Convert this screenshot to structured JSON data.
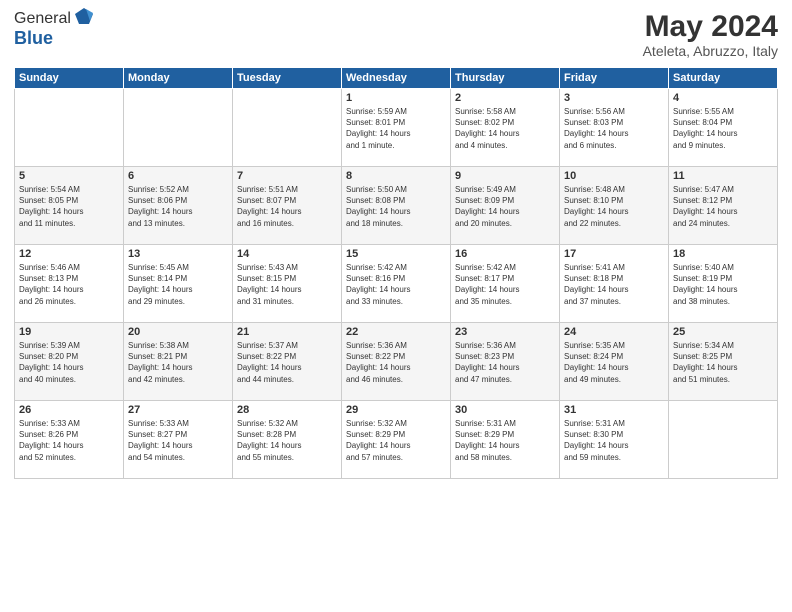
{
  "logo": {
    "general": "General",
    "blue": "Blue"
  },
  "title": "May 2024",
  "subtitle": "Ateleta, Abruzzo, Italy",
  "days_header": [
    "Sunday",
    "Monday",
    "Tuesday",
    "Wednesday",
    "Thursday",
    "Friday",
    "Saturday"
  ],
  "weeks": [
    [
      {
        "num": "",
        "info": ""
      },
      {
        "num": "",
        "info": ""
      },
      {
        "num": "",
        "info": ""
      },
      {
        "num": "1",
        "info": "Sunrise: 5:59 AM\nSunset: 8:01 PM\nDaylight: 14 hours\nand 1 minute."
      },
      {
        "num": "2",
        "info": "Sunrise: 5:58 AM\nSunset: 8:02 PM\nDaylight: 14 hours\nand 4 minutes."
      },
      {
        "num": "3",
        "info": "Sunrise: 5:56 AM\nSunset: 8:03 PM\nDaylight: 14 hours\nand 6 minutes."
      },
      {
        "num": "4",
        "info": "Sunrise: 5:55 AM\nSunset: 8:04 PM\nDaylight: 14 hours\nand 9 minutes."
      }
    ],
    [
      {
        "num": "5",
        "info": "Sunrise: 5:54 AM\nSunset: 8:05 PM\nDaylight: 14 hours\nand 11 minutes."
      },
      {
        "num": "6",
        "info": "Sunrise: 5:52 AM\nSunset: 8:06 PM\nDaylight: 14 hours\nand 13 minutes."
      },
      {
        "num": "7",
        "info": "Sunrise: 5:51 AM\nSunset: 8:07 PM\nDaylight: 14 hours\nand 16 minutes."
      },
      {
        "num": "8",
        "info": "Sunrise: 5:50 AM\nSunset: 8:08 PM\nDaylight: 14 hours\nand 18 minutes."
      },
      {
        "num": "9",
        "info": "Sunrise: 5:49 AM\nSunset: 8:09 PM\nDaylight: 14 hours\nand 20 minutes."
      },
      {
        "num": "10",
        "info": "Sunrise: 5:48 AM\nSunset: 8:10 PM\nDaylight: 14 hours\nand 22 minutes."
      },
      {
        "num": "11",
        "info": "Sunrise: 5:47 AM\nSunset: 8:12 PM\nDaylight: 14 hours\nand 24 minutes."
      }
    ],
    [
      {
        "num": "12",
        "info": "Sunrise: 5:46 AM\nSunset: 8:13 PM\nDaylight: 14 hours\nand 26 minutes."
      },
      {
        "num": "13",
        "info": "Sunrise: 5:45 AM\nSunset: 8:14 PM\nDaylight: 14 hours\nand 29 minutes."
      },
      {
        "num": "14",
        "info": "Sunrise: 5:43 AM\nSunset: 8:15 PM\nDaylight: 14 hours\nand 31 minutes."
      },
      {
        "num": "15",
        "info": "Sunrise: 5:42 AM\nSunset: 8:16 PM\nDaylight: 14 hours\nand 33 minutes."
      },
      {
        "num": "16",
        "info": "Sunrise: 5:42 AM\nSunset: 8:17 PM\nDaylight: 14 hours\nand 35 minutes."
      },
      {
        "num": "17",
        "info": "Sunrise: 5:41 AM\nSunset: 8:18 PM\nDaylight: 14 hours\nand 37 minutes."
      },
      {
        "num": "18",
        "info": "Sunrise: 5:40 AM\nSunset: 8:19 PM\nDaylight: 14 hours\nand 38 minutes."
      }
    ],
    [
      {
        "num": "19",
        "info": "Sunrise: 5:39 AM\nSunset: 8:20 PM\nDaylight: 14 hours\nand 40 minutes."
      },
      {
        "num": "20",
        "info": "Sunrise: 5:38 AM\nSunset: 8:21 PM\nDaylight: 14 hours\nand 42 minutes."
      },
      {
        "num": "21",
        "info": "Sunrise: 5:37 AM\nSunset: 8:22 PM\nDaylight: 14 hours\nand 44 minutes."
      },
      {
        "num": "22",
        "info": "Sunrise: 5:36 AM\nSunset: 8:22 PM\nDaylight: 14 hours\nand 46 minutes."
      },
      {
        "num": "23",
        "info": "Sunrise: 5:36 AM\nSunset: 8:23 PM\nDaylight: 14 hours\nand 47 minutes."
      },
      {
        "num": "24",
        "info": "Sunrise: 5:35 AM\nSunset: 8:24 PM\nDaylight: 14 hours\nand 49 minutes."
      },
      {
        "num": "25",
        "info": "Sunrise: 5:34 AM\nSunset: 8:25 PM\nDaylight: 14 hours\nand 51 minutes."
      }
    ],
    [
      {
        "num": "26",
        "info": "Sunrise: 5:33 AM\nSunset: 8:26 PM\nDaylight: 14 hours\nand 52 minutes."
      },
      {
        "num": "27",
        "info": "Sunrise: 5:33 AM\nSunset: 8:27 PM\nDaylight: 14 hours\nand 54 minutes."
      },
      {
        "num": "28",
        "info": "Sunrise: 5:32 AM\nSunset: 8:28 PM\nDaylight: 14 hours\nand 55 minutes."
      },
      {
        "num": "29",
        "info": "Sunrise: 5:32 AM\nSunset: 8:29 PM\nDaylight: 14 hours\nand 57 minutes."
      },
      {
        "num": "30",
        "info": "Sunrise: 5:31 AM\nSunset: 8:29 PM\nDaylight: 14 hours\nand 58 minutes."
      },
      {
        "num": "31",
        "info": "Sunrise: 5:31 AM\nSunset: 8:30 PM\nDaylight: 14 hours\nand 59 minutes."
      },
      {
        "num": "",
        "info": ""
      }
    ]
  ]
}
